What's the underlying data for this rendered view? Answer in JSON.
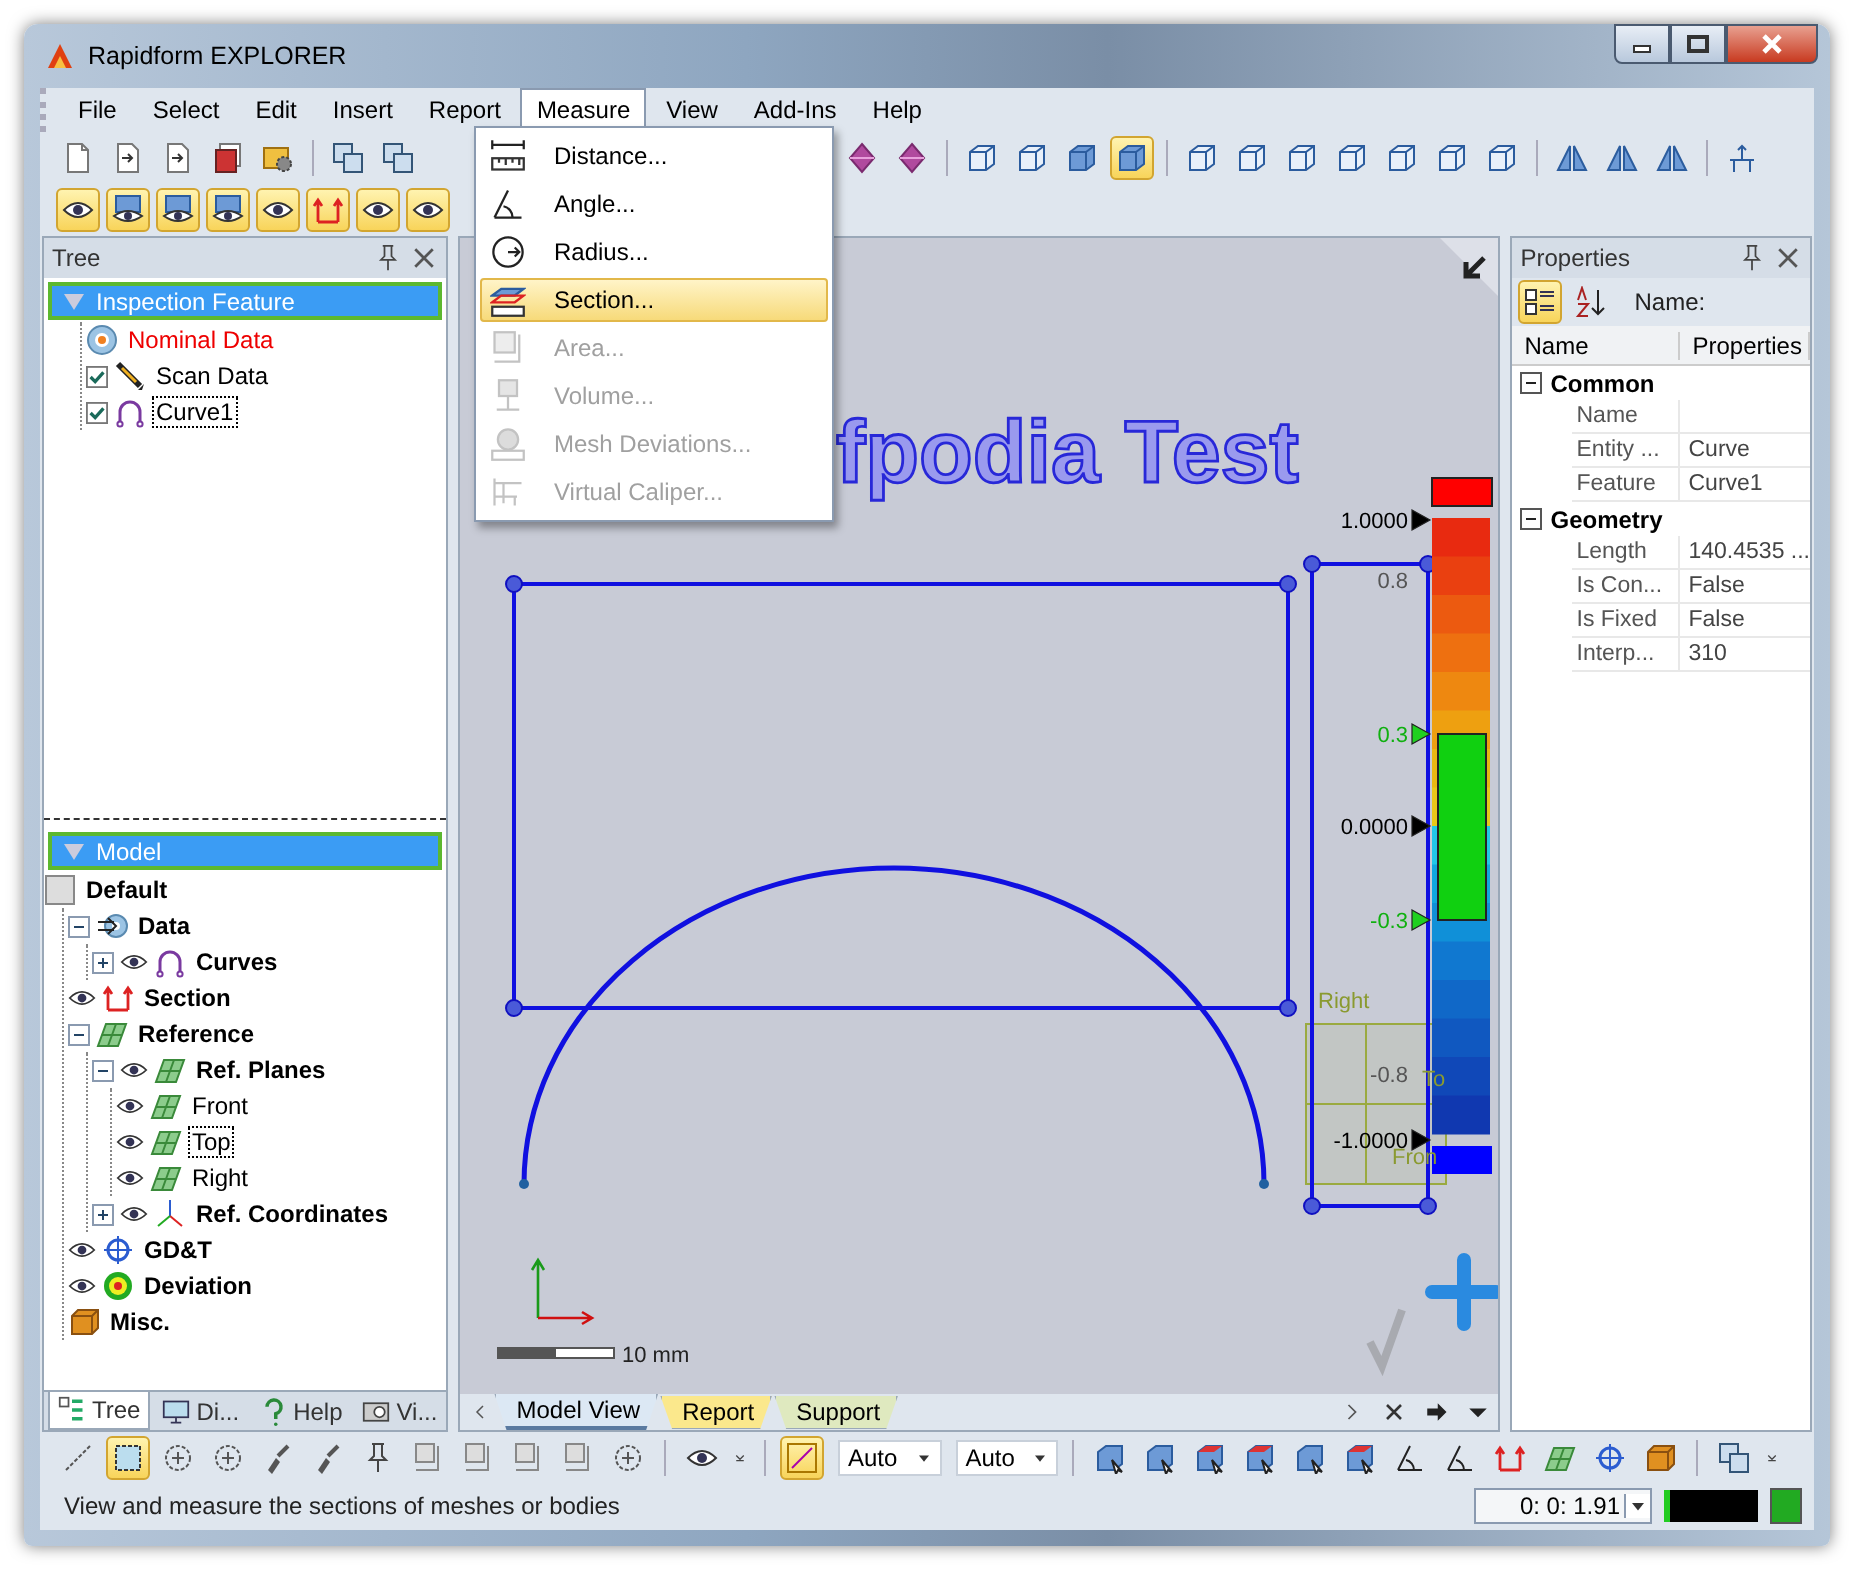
{
  "window": {
    "title": "Rapidform EXPLORER"
  },
  "menu_bar": [
    {
      "label": "File",
      "selected": false
    },
    {
      "label": "Select",
      "selected": false
    },
    {
      "label": "Edit",
      "selected": false
    },
    {
      "label": "Insert",
      "selected": false
    },
    {
      "label": "Report",
      "selected": false
    },
    {
      "label": "Measure",
      "selected": true
    },
    {
      "label": "View",
      "selected": false
    },
    {
      "label": "Add-Ins",
      "selected": false
    },
    {
      "label": "Help",
      "selected": false
    }
  ],
  "measure_menu": [
    {
      "label": "Distance...",
      "kind": "distance",
      "disabled": false,
      "selected": false
    },
    {
      "label": "Angle...",
      "kind": "angle",
      "disabled": false,
      "selected": false
    },
    {
      "label": "Radius...",
      "kind": "radius",
      "disabled": false,
      "selected": false
    },
    {
      "label": "Section...",
      "kind": "section",
      "disabled": false,
      "selected": true
    },
    {
      "label": "Area...",
      "kind": "area",
      "disabled": true,
      "selected": false
    },
    {
      "label": "Volume...",
      "kind": "volume",
      "disabled": true,
      "selected": false
    },
    {
      "label": "Mesh Deviations...",
      "kind": "mesh",
      "disabled": true,
      "selected": false
    },
    {
      "label": "Virtual Caliper...",
      "kind": "caliper",
      "disabled": true,
      "selected": false
    }
  ],
  "tree_pane": {
    "title": "Tree",
    "inspection": {
      "label": "Inspection Feature",
      "selected": true,
      "children": [
        {
          "label": "Nominal Data",
          "kind": "nominal"
        },
        {
          "label": "Scan Data",
          "kind": "scan",
          "checked": true
        },
        {
          "label": "Curve1",
          "kind": "curve",
          "checked": true,
          "focused": true
        }
      ]
    },
    "model": {
      "label": "Model",
      "selected": true,
      "children": [
        {
          "label": "Default",
          "kind": "default",
          "visible": false,
          "children": [
            {
              "label": "Data",
              "kind": "data",
              "visible": false,
              "expanded": true,
              "children": [
                {
                  "label": "Curves",
                  "kind": "curve",
                  "visible": true,
                  "expanded": false
                }
              ]
            },
            {
              "label": "Section",
              "kind": "section",
              "visible": true
            },
            {
              "label": "Reference",
              "kind": "plane",
              "visible": false,
              "expanded": true,
              "children": [
                {
                  "label": "Ref. Planes",
                  "kind": "plane",
                  "visible": true,
                  "expanded": true,
                  "children": [
                    {
                      "label": "Front",
                      "kind": "plane",
                      "visible": true
                    },
                    {
                      "label": "Top",
                      "kind": "plane",
                      "visible": true,
                      "focused": true
                    },
                    {
                      "label": "Right",
                      "kind": "plane",
                      "visible": true
                    }
                  ]
                },
                {
                  "label": "Ref. Coordinates",
                  "kind": "axes",
                  "visible": true,
                  "expanded": false
                }
              ]
            },
            {
              "label": "GD&T",
              "kind": "gdt",
              "visible": true
            },
            {
              "label": "Deviation",
              "kind": "deviation",
              "visible": true
            },
            {
              "label": "Misc.",
              "kind": "misc",
              "visible": false
            }
          ]
        }
      ]
    },
    "tabs": [
      {
        "label": "Tree",
        "kind": "tree",
        "selected": true
      },
      {
        "label": "Di...",
        "kind": "display",
        "selected": false
      },
      {
        "label": "Help",
        "kind": "help",
        "selected": false
      },
      {
        "label": "Vi...",
        "kind": "view",
        "selected": false
      }
    ]
  },
  "viewport": {
    "model_text": "fpodia Test",
    "color_scale": [
      {
        "text": "1.0000",
        "kind": "limit"
      },
      {
        "text": "0.8",
        "kind": "tick"
      },
      {
        "text": "0.3",
        "kind": "tolerance"
      },
      {
        "text": "0.0000",
        "kind": "limit"
      },
      {
        "text": "-0.3",
        "kind": "tolerance"
      },
      {
        "text": "-0.8",
        "kind": "tick"
      },
      {
        "text": "-1.0000",
        "kind": "limit"
      }
    ],
    "view_cube": [
      "Right",
      "To",
      "Fron"
    ],
    "scale_bar": "10 mm",
    "tabs": [
      {
        "label": "Model View",
        "selected": true,
        "color": "#dce8f4"
      },
      {
        "label": "Report",
        "selected": false,
        "color": "#fbe88c"
      },
      {
        "label": "Support",
        "selected": false,
        "color": "#dfe9bf"
      }
    ]
  },
  "properties": {
    "title": "Properties",
    "name_label": "Name:",
    "columns": [
      "Name",
      "Properties"
    ],
    "groups": [
      {
        "label": "Common",
        "expanded": true,
        "rows": [
          {
            "name": "Name"
          },
          {
            "name": "Entity ...",
            "value": "Curve"
          },
          {
            "name": "Feature",
            "value": "Curve1"
          }
        ]
      },
      {
        "label": "Geometry",
        "expanded": true,
        "rows": [
          {
            "name": "Length",
            "value": "140.4535 ..."
          },
          {
            "name": "Is Con...",
            "value": "False"
          },
          {
            "name": "Is Fixed",
            "value": "False"
          },
          {
            "name": "Interp...",
            "value": "310"
          }
        ]
      }
    ]
  },
  "bottom_toolbar": {
    "dropdowns": [
      "Auto",
      "Auto"
    ]
  },
  "status_bar": {
    "message": "View and measure the sections of meshes or bodies",
    "coordinate": "0: 0: 1.91"
  }
}
